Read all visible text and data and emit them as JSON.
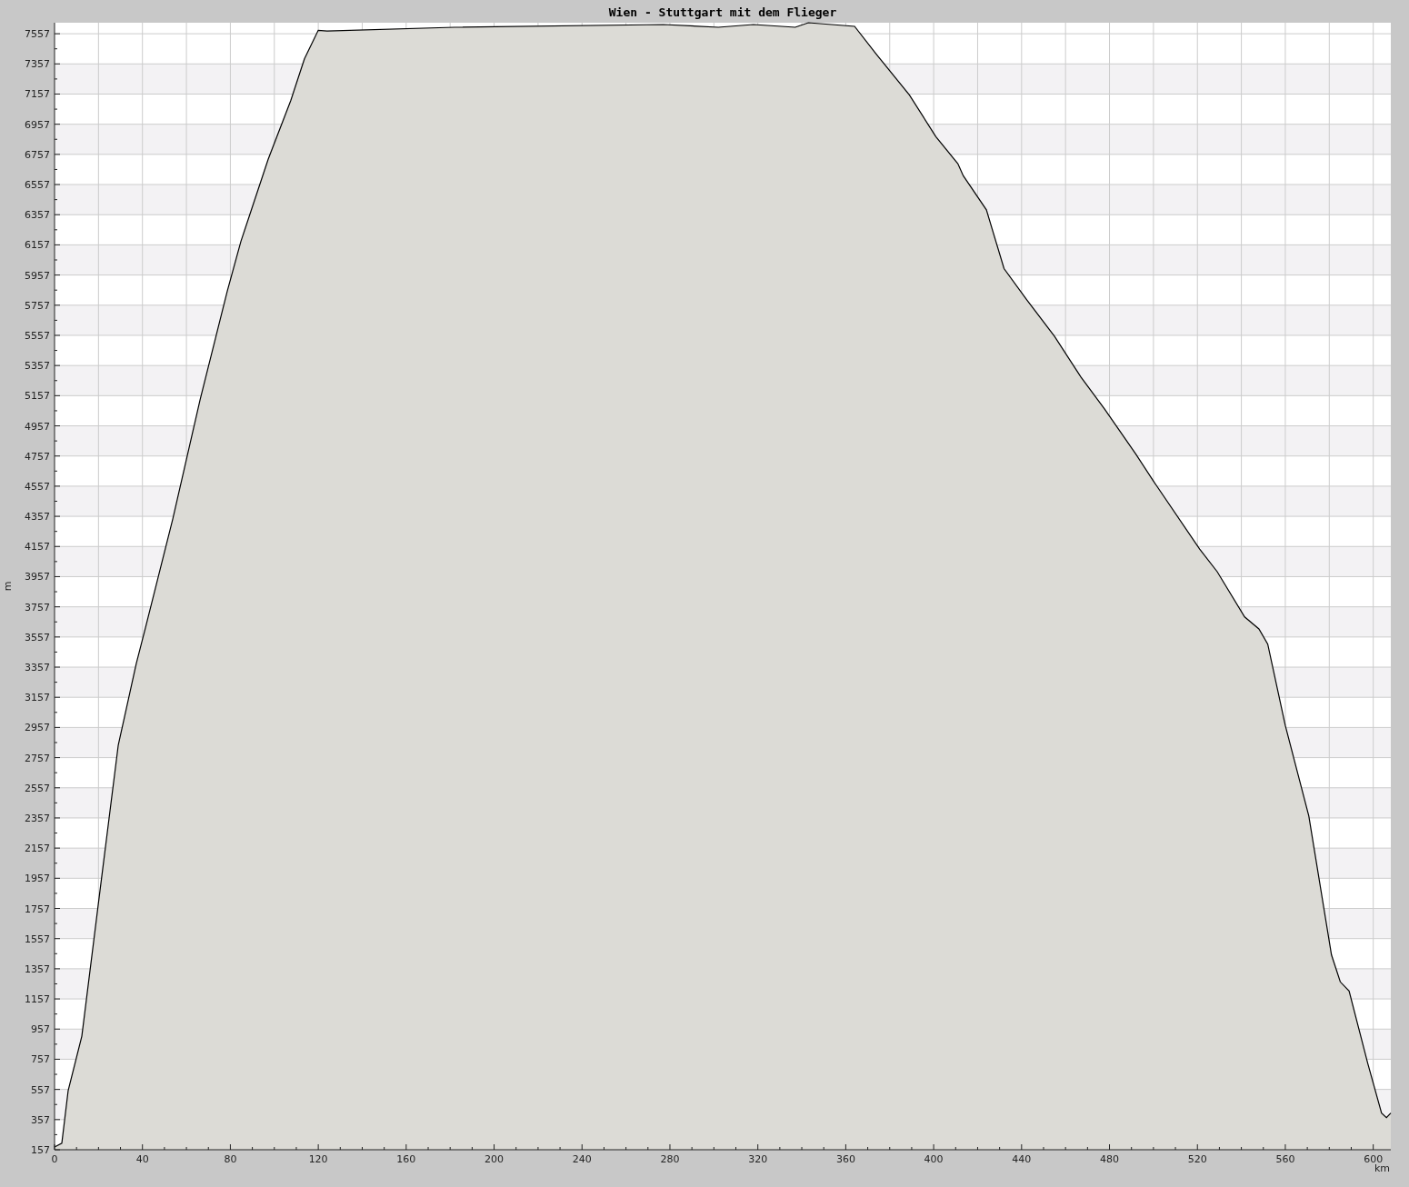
{
  "chart": {
    "chart_data": {
      "type": "area",
      "title": "Wien - Stuttgart mit dem Flieger",
      "xlabel": "km",
      "ylabel": "m",
      "x": [
        0,
        3.3,
        6.2,
        12.4,
        20.7,
        29,
        37.2,
        41.4,
        53.8,
        66.2,
        78.6,
        84.8,
        97.2,
        107.5,
        113.7,
        120,
        124,
        182,
        277,
        302,
        318,
        337,
        343,
        364,
        374,
        389,
        401,
        411,
        413.5,
        424,
        432,
        442.5,
        455,
        467,
        477.7,
        492,
        500,
        521,
        529,
        541.5,
        548,
        552,
        560,
        570.7,
        581,
        585,
        589,
        597.5,
        603.8,
        606,
        608
      ],
      "values": [
        175,
        200,
        550,
        910,
        1875,
        2840,
        3380,
        3620,
        4340,
        5130,
        5850,
        6180,
        6725,
        7115,
        7390,
        7580,
        7575,
        7600,
        7618,
        7600,
        7618,
        7600,
        7630,
        7606,
        7420,
        7150,
        6875,
        6695,
        6615,
        6390,
        6000,
        5790,
        5550,
        5280,
        5070,
        4770,
        4590,
        4140,
        3990,
        3690,
        3610,
        3510,
        2970,
        2370,
        1450,
        1270,
        1210,
        730,
        400,
        370,
        400
      ],
      "grid": true,
      "xlim": [
        0,
        608
      ],
      "ylim": [
        157,
        7630
      ],
      "xticks": [
        0,
        40,
        80,
        120,
        160,
        200,
        240,
        280,
        320,
        360,
        400,
        440,
        480,
        520,
        560,
        600
      ],
      "yticks": [
        157,
        357,
        557,
        757,
        957,
        1157,
        1357,
        1557,
        1757,
        1957,
        2157,
        2357,
        2557,
        2757,
        2957,
        3157,
        3357,
        3557,
        3757,
        3957,
        4157,
        4357,
        4557,
        4757,
        4957,
        5157,
        5357,
        5557,
        5757,
        5957,
        6157,
        6357,
        6557,
        6757,
        6957,
        7157,
        7357,
        7557
      ]
    }
  }
}
